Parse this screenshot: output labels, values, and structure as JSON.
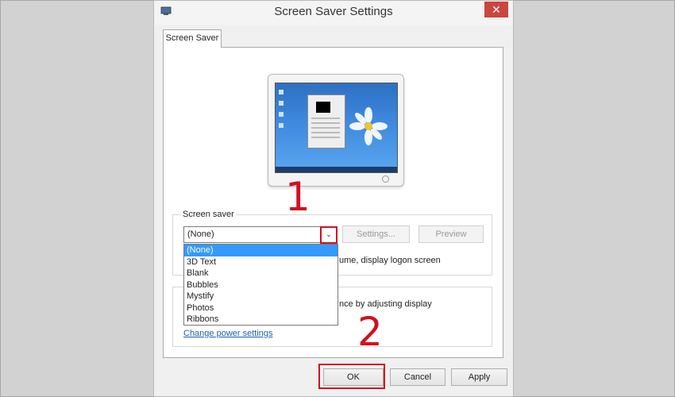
{
  "window": {
    "title": "Screen Saver Settings",
    "close_glyph": "✕"
  },
  "tabs": [
    {
      "label": "Screen Saver"
    }
  ],
  "screen_saver": {
    "group_label": "Screen saver",
    "selected": "(None)",
    "settings_button": "Settings...",
    "preview_button": "Preview",
    "options": [
      "(None)",
      "3D Text",
      "Blank",
      "Bubbles",
      "Mystify",
      "Photos",
      "Ribbons"
    ],
    "resume_text_fragment": "ume, display logon screen"
  },
  "power": {
    "text_fragment": "nce by adjusting display",
    "link": "Change power settings"
  },
  "buttons": {
    "ok": "OK",
    "cancel": "Cancel",
    "apply": "Apply"
  },
  "annotations": {
    "step1": "1",
    "step2": "2",
    "color": "#d0101f"
  },
  "icons": [
    "screensaver-app-icon",
    "close-icon",
    "chevron-down-icon",
    "monitor-preview-icon"
  ]
}
